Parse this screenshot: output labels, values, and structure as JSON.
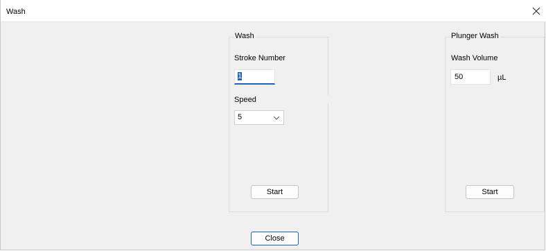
{
  "window": {
    "title": "Wash",
    "close_label": "Close"
  },
  "wash": {
    "group_label": "Wash",
    "stroke_label": "Stroke Number",
    "stroke_value": "1",
    "speed_label": "Speed",
    "speed_value": "5",
    "start_label": "Start"
  },
  "plunger": {
    "group_label": "Plunger Wash",
    "volume_label": "Wash Volume",
    "volume_value": "50",
    "volume_unit": "µL",
    "start_label": "Start"
  },
  "icons": {
    "close": "close-icon",
    "dropdown": "chevron-down-icon"
  },
  "colors": {
    "accent": "#1c62b9",
    "window_bg": "#f0f0f0"
  }
}
